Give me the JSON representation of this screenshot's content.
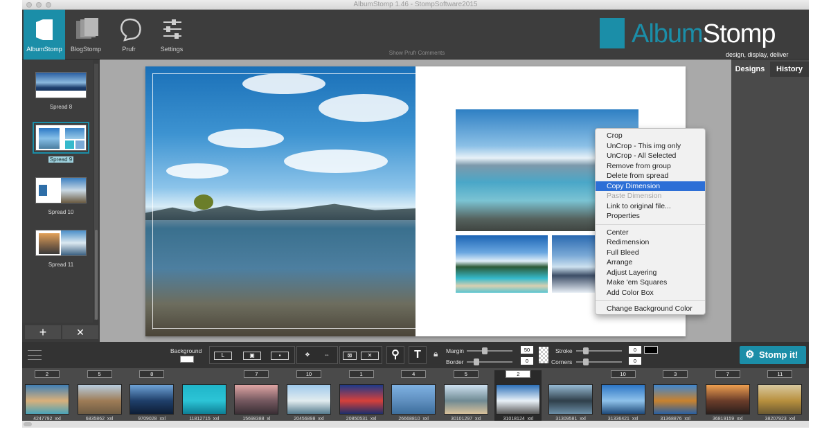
{
  "window": {
    "title": "AlbumStomp 1.46 - StompSoftware2015"
  },
  "toolbar": {
    "buttons": [
      {
        "label": "AlbumStomp",
        "icon": "album-icon"
      },
      {
        "label": "BlogStomp",
        "icon": "blog-icon"
      },
      {
        "label": "Prufr",
        "icon": "prufr-icon"
      },
      {
        "label": "Settings",
        "icon": "sliders-icon"
      }
    ],
    "show_comments": "Show Prufr Comments"
  },
  "logo": {
    "name_a": "Album",
    "name_b": "Stomp",
    "tagline": "design, display, deliver",
    "accent": "#1b8ea8"
  },
  "spreads": [
    {
      "label": "Spread 8"
    },
    {
      "label": "Spread 9"
    },
    {
      "label": "Spread 10"
    },
    {
      "label": "Spread 11"
    }
  ],
  "left_buttons": {
    "add": "+",
    "remove": "✕"
  },
  "right_tabs": {
    "designs": "Designs",
    "history": "History"
  },
  "context_menu": {
    "group1": [
      "Crop",
      "UnCrop - This img only",
      "UnCrop - All Selected",
      "Remove from group",
      "Delete from spread",
      "Copy Dimension",
      "Paste Dimension",
      "Link to original file...",
      "Properties"
    ],
    "group2": [
      "Center",
      "Redimension",
      "Full Bleed",
      "Arrange",
      "Adjust Layering",
      "Make 'em Squares",
      "Add Color Box"
    ],
    "group3": [
      "Change Background Color"
    ],
    "highlighted": "Copy Dimension",
    "disabled": "Paste Dimension"
  },
  "bottom": {
    "background_label": "Background",
    "margin_label": "Margin",
    "margin_value": "50",
    "border_label": "Border",
    "border_value": "0",
    "stroke_label": "Stroke",
    "stroke_value": "0",
    "corners_label": "Corners",
    "corners_value": "0",
    "text_tool": "T",
    "stomp_button": "Stomp it!"
  },
  "filmstrip": [
    {
      "count": "2",
      "name": "4247792_xxl",
      "colors": [
        "#3f7fb5",
        "#d9b07a",
        "#4aa3b8"
      ]
    },
    {
      "count": "5",
      "name": "6835862_xxl",
      "colors": [
        "#b8cde0",
        "#9e7c56",
        "#6e5c44"
      ]
    },
    {
      "count": "8",
      "name": "9709028_xxl",
      "colors": [
        "#6fa4d8",
        "#1f3f6a",
        "#0e1e36"
      ]
    },
    {
      "count": "",
      "name": "11812715_xxl",
      "colors": [
        "#1fb5c9",
        "#2cc4d6",
        "#0e7f95"
      ]
    },
    {
      "count": "7",
      "name": "15698388_xl",
      "colors": [
        "#e1a6a5",
        "#74585f",
        "#3a2f35"
      ]
    },
    {
      "count": "10",
      "name": "20456898_xxl",
      "colors": [
        "#9fc9ec",
        "#e2ecef",
        "#557b8e"
      ]
    },
    {
      "count": "1",
      "name": "20850531_xxl",
      "colors": [
        "#1c3a8a",
        "#d6403a",
        "#1d2f6b"
      ]
    },
    {
      "count": "4",
      "name": "26668810_xxl",
      "colors": [
        "#7fb2e3",
        "#5f8fbf",
        "#3d6e9c"
      ]
    },
    {
      "count": "5",
      "name": "30101297_xxl",
      "colors": [
        "#cfe2f2",
        "#6f8a93",
        "#d8c19a"
      ]
    },
    {
      "count": "2",
      "name": "31018124_xxl",
      "colors": [
        "#2b6fb8",
        "#e9f1f8",
        "#5a5a5a"
      ]
    },
    {
      "count": "",
      "name": "31309581_xxl",
      "colors": [
        "#98bcd6",
        "#2f3f4a",
        "#6b8ea6"
      ]
    },
    {
      "count": "10",
      "name": "31336421_xxl",
      "colors": [
        "#2b75c5",
        "#8fc2ea",
        "#1f4a7a"
      ]
    },
    {
      "count": "3",
      "name": "31368876_xxl",
      "colors": [
        "#3e86cf",
        "#c9822e",
        "#2a5fa0"
      ]
    },
    {
      "count": "7",
      "name": "36819159_xxl",
      "colors": [
        "#f0a050",
        "#6b3d2a",
        "#2a1f1c"
      ]
    },
    {
      "count": "11",
      "name": "38207923_xxl",
      "colors": [
        "#d9c9a0",
        "#b8903e",
        "#6c5a32"
      ]
    }
  ],
  "selected_film_index": 9
}
